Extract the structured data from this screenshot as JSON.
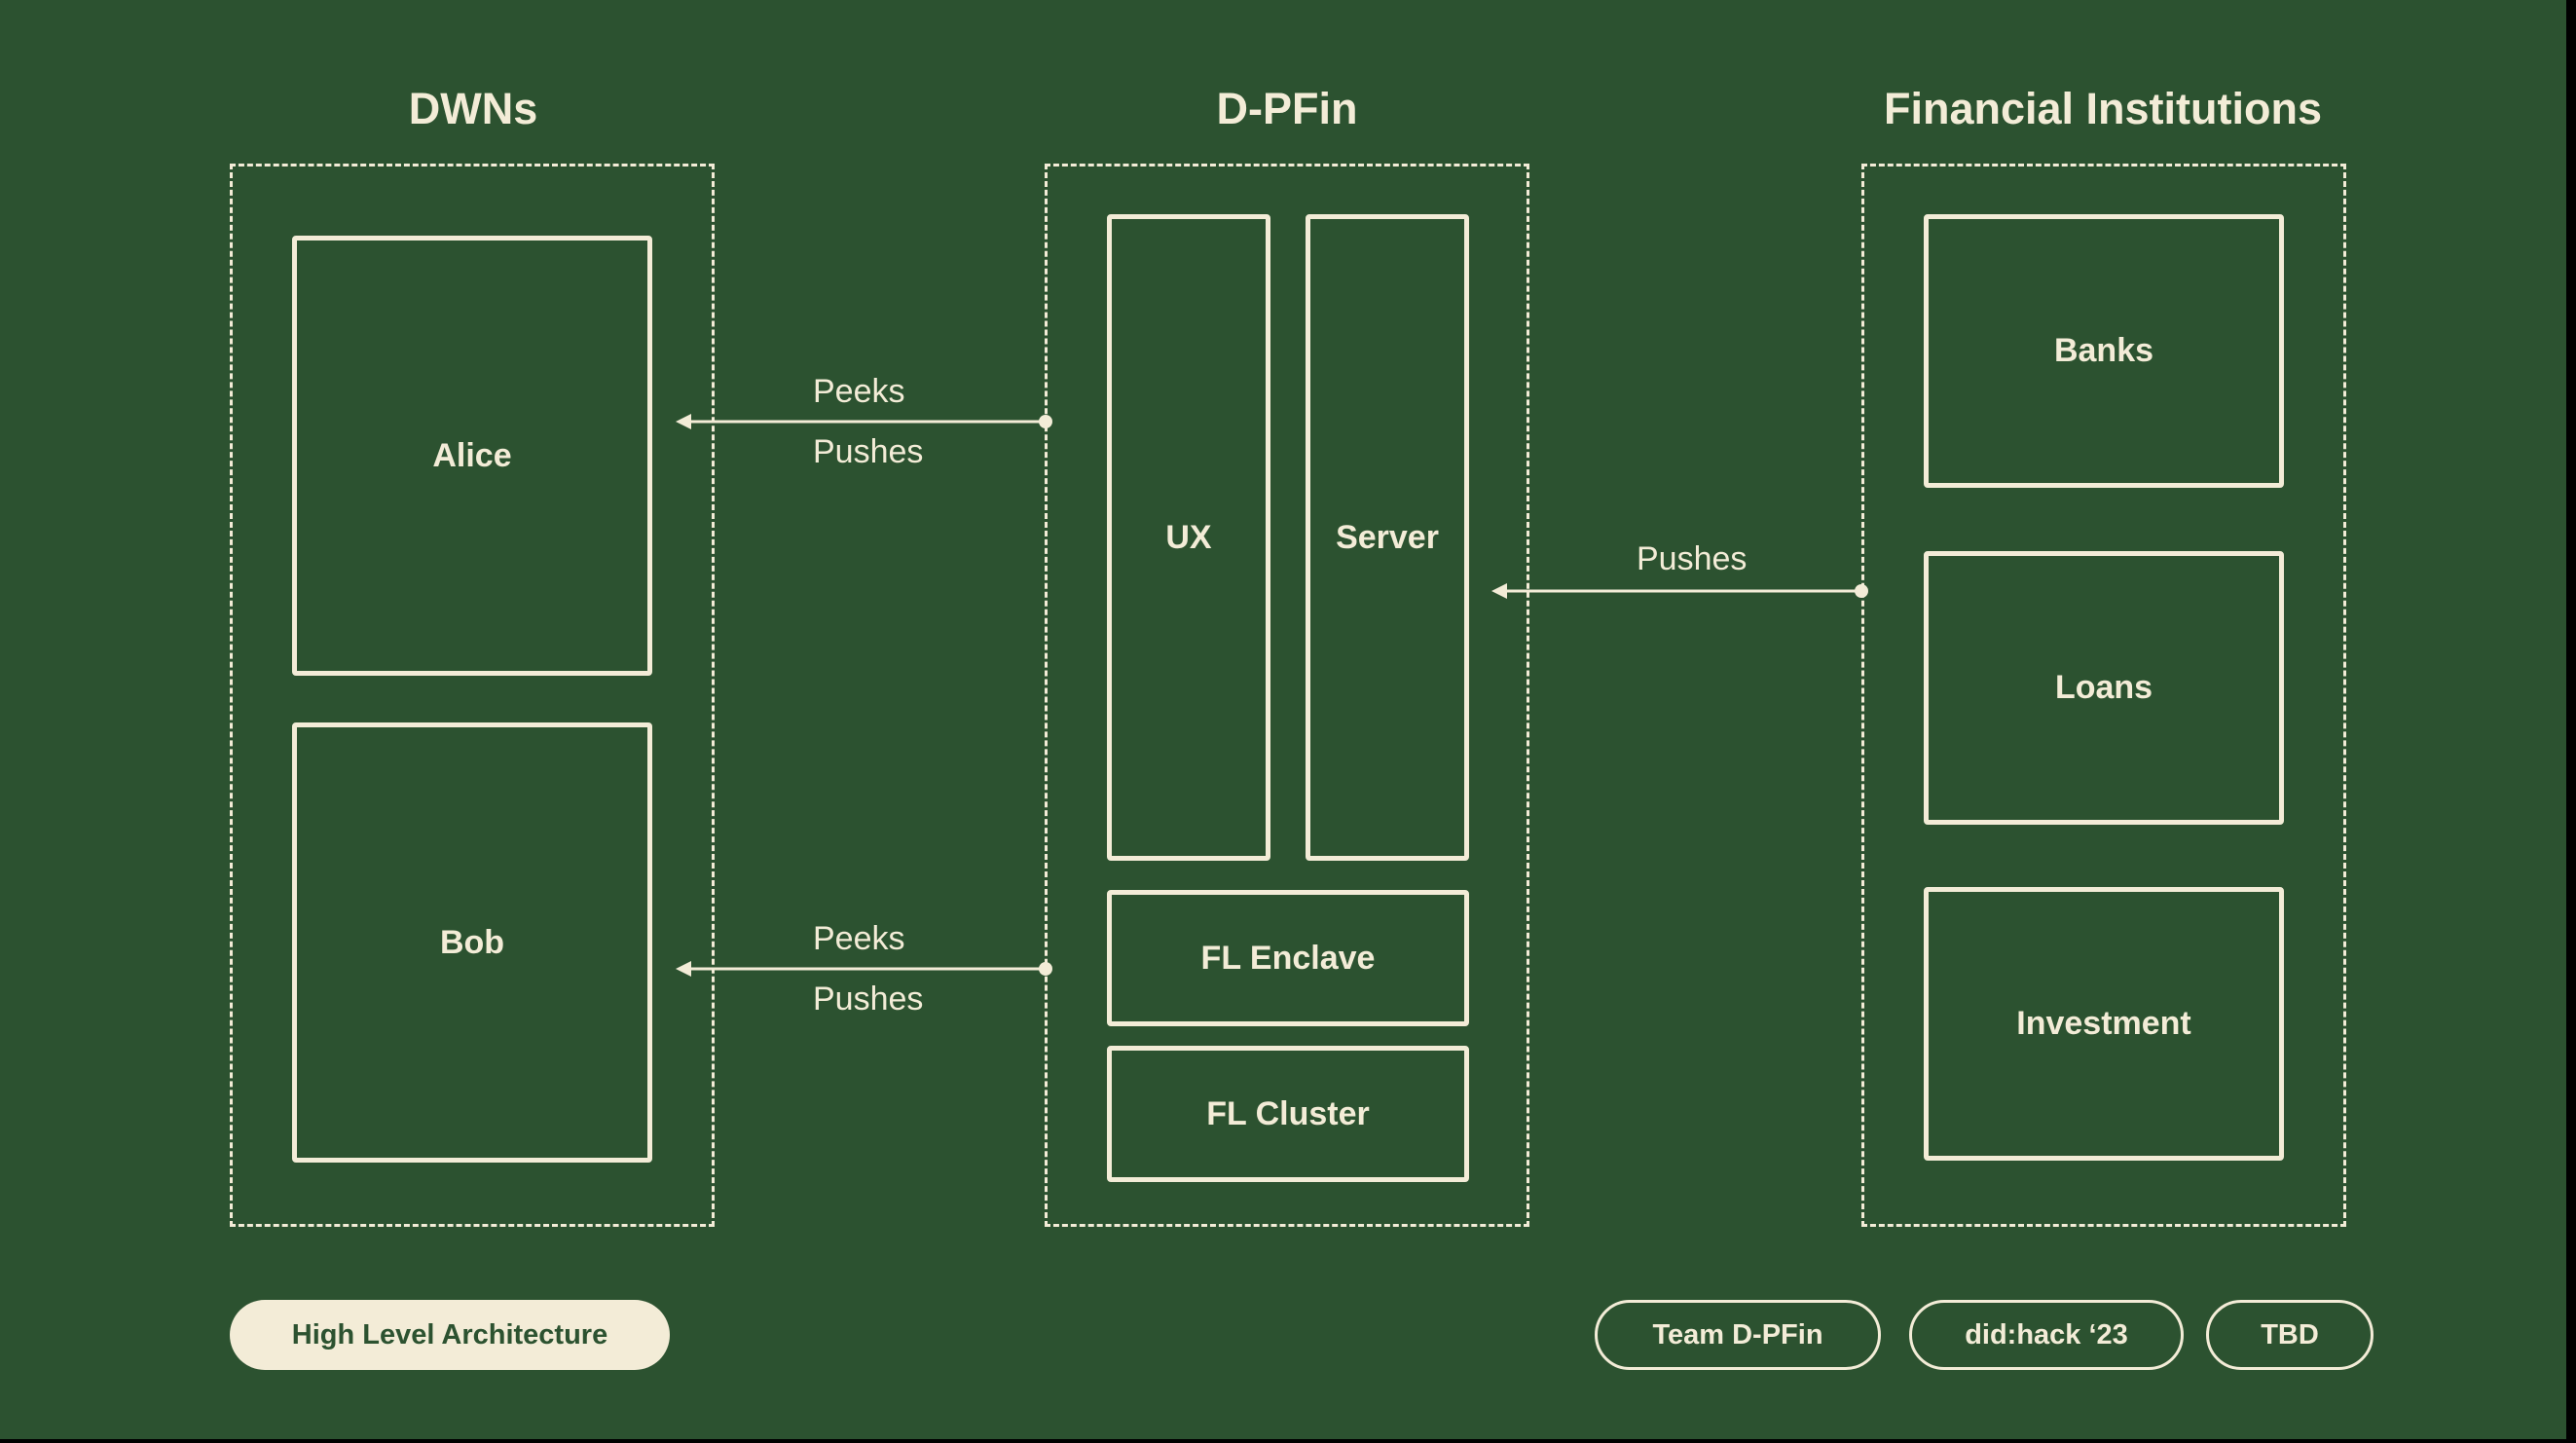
{
  "groups": {
    "dwns": {
      "title": "DWNs",
      "boxes": {
        "alice": "Alice",
        "bob": "Bob"
      }
    },
    "dpfin": {
      "title": "D-PFin",
      "boxes": {
        "ux": "UX",
        "server": "Server",
        "fl_enclave": "FL Enclave",
        "fl_cluster": "FL Cluster"
      }
    },
    "financial": {
      "title": "Financial Institutions",
      "boxes": {
        "banks": "Banks",
        "loans": "Loans",
        "investment": "Investment"
      }
    }
  },
  "arrows": {
    "alice_link": {
      "top_label": "Peeks",
      "bottom_label": "Pushes"
    },
    "bob_link": {
      "top_label": "Peeks",
      "bottom_label": "Pushes"
    },
    "financial_link": {
      "label": "Pushes"
    }
  },
  "footer": {
    "section_label": "High Level Architecture",
    "tags": {
      "team": "Team D-PFin",
      "event": "did:hack ‘23",
      "org": "TBD"
    }
  },
  "colors": {
    "background": "#2c5230",
    "foreground": "#f3ecd7"
  }
}
